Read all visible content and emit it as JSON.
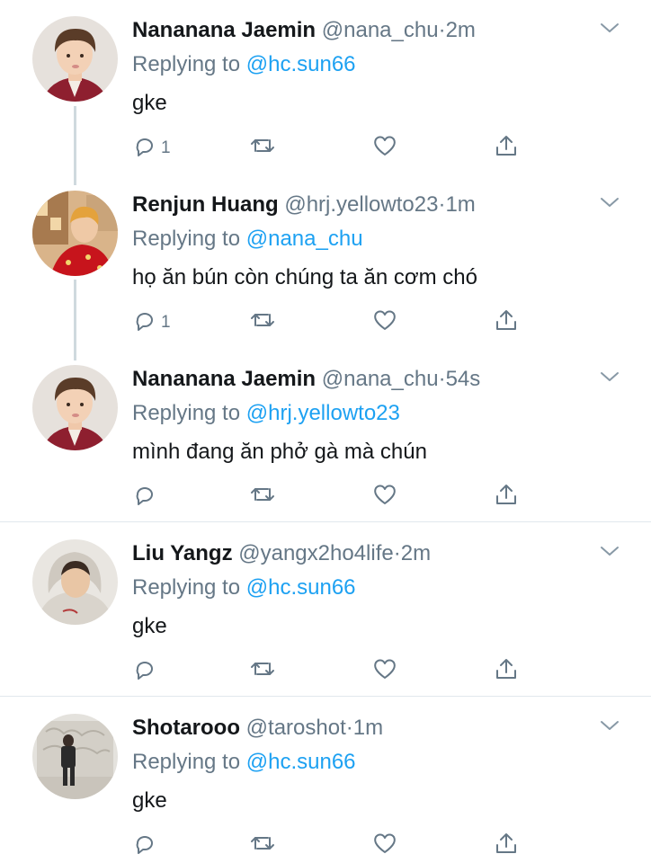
{
  "tweets": [
    {
      "name": "Nananana Jaemin",
      "handle": "@nana_chu",
      "sep": "·",
      "time": "2m",
      "reply_prefix": "Replying to",
      "reply_handle": "@hc.sun66",
      "text": "gke",
      "reply_count": "1",
      "avatar_icon": "avatar-jaemin"
    },
    {
      "name": "Renjun Huang",
      "handle": "@hrj.yellowto23",
      "sep": "·",
      "time": "1m",
      "reply_prefix": "Replying to",
      "reply_handle": "@nana_chu",
      "text": "họ ăn bún còn chúng ta ăn cơm chó",
      "reply_count": "1",
      "avatar_icon": "avatar-renjun"
    },
    {
      "name": "Nananana Jaemin",
      "handle": "@nana_chu",
      "sep": "·",
      "time": "54s",
      "reply_prefix": "Replying to",
      "reply_handle": "@hrj.yellowto23",
      "text": "mình đang ăn phở gà mà chún",
      "reply_count": "",
      "avatar_icon": "avatar-jaemin"
    },
    {
      "name": "Liu Yangz",
      "handle": "@yangx2ho4life",
      "sep": "·",
      "time": "2m",
      "reply_prefix": "Replying to",
      "reply_handle": "@hc.sun66",
      "text": "gke",
      "reply_count": "",
      "avatar_icon": "avatar-liu"
    },
    {
      "name": "Shotarooo",
      "handle": "@taroshot",
      "sep": "·",
      "time": "1m",
      "reply_prefix": "Replying to",
      "reply_handle": "@hc.sun66",
      "text": "gke",
      "reply_count": "",
      "avatar_icon": "avatar-shotaro"
    }
  ],
  "icons": {
    "reply": "reply-icon",
    "retweet": "retweet-icon",
    "like": "heart-icon",
    "share": "share-icon",
    "more": "chevron-down-icon"
  },
  "colors": {
    "link": "#1da1f2",
    "secondary_text": "#657786",
    "primary_text": "#14171a",
    "divider": "#e1e8ed",
    "thread_line": "#cfd9de"
  }
}
